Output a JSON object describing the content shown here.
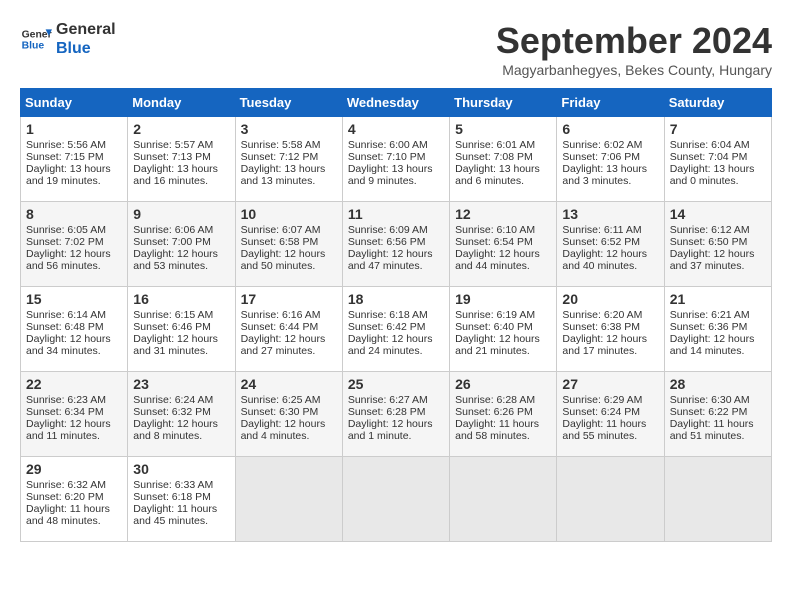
{
  "logo": {
    "line1": "General",
    "line2": "Blue"
  },
  "title": "September 2024",
  "subtitle": "Magyarbanhegyes, Bekes County, Hungary",
  "days_of_week": [
    "Sunday",
    "Monday",
    "Tuesday",
    "Wednesday",
    "Thursday",
    "Friday",
    "Saturday"
  ],
  "weeks": [
    [
      {
        "day": "1",
        "info": "Sunrise: 5:56 AM\nSunset: 7:15 PM\nDaylight: 13 hours and 19 minutes."
      },
      {
        "day": "2",
        "info": "Sunrise: 5:57 AM\nSunset: 7:13 PM\nDaylight: 13 hours and 16 minutes."
      },
      {
        "day": "3",
        "info": "Sunrise: 5:58 AM\nSunset: 7:12 PM\nDaylight: 13 hours and 13 minutes."
      },
      {
        "day": "4",
        "info": "Sunrise: 6:00 AM\nSunset: 7:10 PM\nDaylight: 13 hours and 9 minutes."
      },
      {
        "day": "5",
        "info": "Sunrise: 6:01 AM\nSunset: 7:08 PM\nDaylight: 13 hours and 6 minutes."
      },
      {
        "day": "6",
        "info": "Sunrise: 6:02 AM\nSunset: 7:06 PM\nDaylight: 13 hours and 3 minutes."
      },
      {
        "day": "7",
        "info": "Sunrise: 6:04 AM\nSunset: 7:04 PM\nDaylight: 13 hours and 0 minutes."
      }
    ],
    [
      {
        "day": "8",
        "info": "Sunrise: 6:05 AM\nSunset: 7:02 PM\nDaylight: 12 hours and 56 minutes."
      },
      {
        "day": "9",
        "info": "Sunrise: 6:06 AM\nSunset: 7:00 PM\nDaylight: 12 hours and 53 minutes."
      },
      {
        "day": "10",
        "info": "Sunrise: 6:07 AM\nSunset: 6:58 PM\nDaylight: 12 hours and 50 minutes."
      },
      {
        "day": "11",
        "info": "Sunrise: 6:09 AM\nSunset: 6:56 PM\nDaylight: 12 hours and 47 minutes."
      },
      {
        "day": "12",
        "info": "Sunrise: 6:10 AM\nSunset: 6:54 PM\nDaylight: 12 hours and 44 minutes."
      },
      {
        "day": "13",
        "info": "Sunrise: 6:11 AM\nSunset: 6:52 PM\nDaylight: 12 hours and 40 minutes."
      },
      {
        "day": "14",
        "info": "Sunrise: 6:12 AM\nSunset: 6:50 PM\nDaylight: 12 hours and 37 minutes."
      }
    ],
    [
      {
        "day": "15",
        "info": "Sunrise: 6:14 AM\nSunset: 6:48 PM\nDaylight: 12 hours and 34 minutes."
      },
      {
        "day": "16",
        "info": "Sunrise: 6:15 AM\nSunset: 6:46 PM\nDaylight: 12 hours and 31 minutes."
      },
      {
        "day": "17",
        "info": "Sunrise: 6:16 AM\nSunset: 6:44 PM\nDaylight: 12 hours and 27 minutes."
      },
      {
        "day": "18",
        "info": "Sunrise: 6:18 AM\nSunset: 6:42 PM\nDaylight: 12 hours and 24 minutes."
      },
      {
        "day": "19",
        "info": "Sunrise: 6:19 AM\nSunset: 6:40 PM\nDaylight: 12 hours and 21 minutes."
      },
      {
        "day": "20",
        "info": "Sunrise: 6:20 AM\nSunset: 6:38 PM\nDaylight: 12 hours and 17 minutes."
      },
      {
        "day": "21",
        "info": "Sunrise: 6:21 AM\nSunset: 6:36 PM\nDaylight: 12 hours and 14 minutes."
      }
    ],
    [
      {
        "day": "22",
        "info": "Sunrise: 6:23 AM\nSunset: 6:34 PM\nDaylight: 12 hours and 11 minutes."
      },
      {
        "day": "23",
        "info": "Sunrise: 6:24 AM\nSunset: 6:32 PM\nDaylight: 12 hours and 8 minutes."
      },
      {
        "day": "24",
        "info": "Sunrise: 6:25 AM\nSunset: 6:30 PM\nDaylight: 12 hours and 4 minutes."
      },
      {
        "day": "25",
        "info": "Sunrise: 6:27 AM\nSunset: 6:28 PM\nDaylight: 12 hours and 1 minute."
      },
      {
        "day": "26",
        "info": "Sunrise: 6:28 AM\nSunset: 6:26 PM\nDaylight: 11 hours and 58 minutes."
      },
      {
        "day": "27",
        "info": "Sunrise: 6:29 AM\nSunset: 6:24 PM\nDaylight: 11 hours and 55 minutes."
      },
      {
        "day": "28",
        "info": "Sunrise: 6:30 AM\nSunset: 6:22 PM\nDaylight: 11 hours and 51 minutes."
      }
    ],
    [
      {
        "day": "29",
        "info": "Sunrise: 6:32 AM\nSunset: 6:20 PM\nDaylight: 11 hours and 48 minutes."
      },
      {
        "day": "30",
        "info": "Sunrise: 6:33 AM\nSunset: 6:18 PM\nDaylight: 11 hours and 45 minutes."
      },
      {
        "day": "",
        "info": ""
      },
      {
        "day": "",
        "info": ""
      },
      {
        "day": "",
        "info": ""
      },
      {
        "day": "",
        "info": ""
      },
      {
        "day": "",
        "info": ""
      }
    ]
  ]
}
